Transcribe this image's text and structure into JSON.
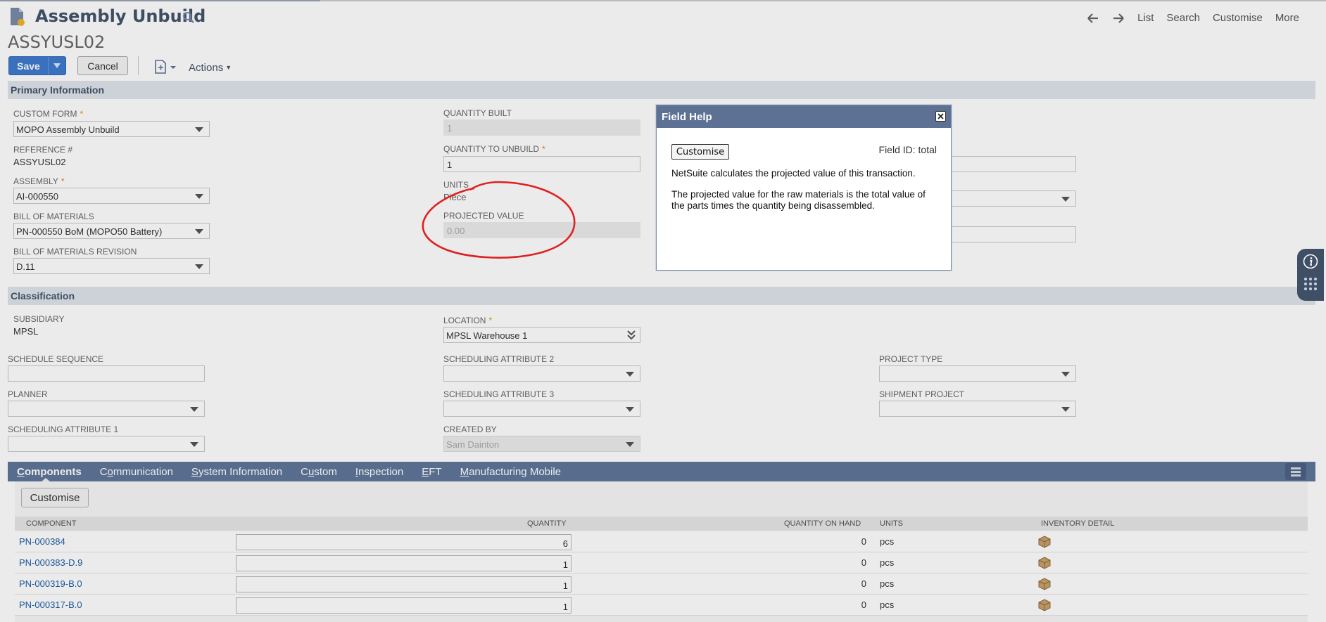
{
  "header": {
    "title": "Assembly Unbuild",
    "record_id": "ASSYUSL02",
    "nav": {
      "list": "List",
      "search": "Search",
      "customise": "Customise",
      "more": "More"
    }
  },
  "toolbar": {
    "save": "Save",
    "cancel": "Cancel",
    "actions": "Actions"
  },
  "primary": {
    "section_title": "Primary Information",
    "custom_form": {
      "label": "CUSTOM FORM",
      "value": "MOPO Assembly Unbuild"
    },
    "reference": {
      "label": "REFERENCE #",
      "value": "ASSYUSL02"
    },
    "assembly": {
      "label": "ASSEMBLY",
      "value": "AI-000550"
    },
    "bom": {
      "label": "BILL OF MATERIALS",
      "value": "PN-000550 BoM (MOPO50 Battery)"
    },
    "bom_rev": {
      "label": "BILL OF MATERIALS REVISION",
      "value": "D.11"
    },
    "qty_built": {
      "label": "QUANTITY BUILT",
      "value": "1"
    },
    "qty_unbuild": {
      "label": "QUANTITY TO UNBUILD",
      "value": "1"
    },
    "units": {
      "label": "UNITS",
      "value": "Piece"
    },
    "projected": {
      "label": "PROJECTED VALUE",
      "value": "0.00"
    }
  },
  "classification": {
    "section_title": "Classification",
    "subsidiary": {
      "label": "SUBSIDIARY",
      "value": "MPSL"
    },
    "location": {
      "label": "LOCATION",
      "value": "MPSL Warehouse 1"
    },
    "schedule_sequence": {
      "label": "SCHEDULE SEQUENCE",
      "value": ""
    },
    "sched_attr2": {
      "label": "SCHEDULING ATTRIBUTE 2",
      "value": ""
    },
    "project_type": {
      "label": "PROJECT TYPE",
      "value": ""
    },
    "planner": {
      "label": "PLANNER",
      "value": ""
    },
    "sched_attr3": {
      "label": "SCHEDULING ATTRIBUTE 3",
      "value": ""
    },
    "shipment_project": {
      "label": "SHIPMENT PROJECT",
      "value": ""
    },
    "sched_attr1": {
      "label": "SCHEDULING ATTRIBUTE 1",
      "value": ""
    },
    "created_by": {
      "label": "CREATED BY",
      "value": "Sam Dainton"
    }
  },
  "tabs": [
    {
      "first": "C",
      "rest": "omponents",
      "active": true
    },
    {
      "pre": "C",
      "first": "o",
      "rest": "mmunication"
    },
    {
      "first": "S",
      "rest": "ystem Information"
    },
    {
      "pre": "C",
      "first": "u",
      "rest": "stom"
    },
    {
      "first": "I",
      "rest": "nspection"
    },
    {
      "first": "E",
      "rest": "FT"
    },
    {
      "first": "M",
      "rest": "anufacturing Mobile"
    }
  ],
  "components": {
    "customise": "Customise",
    "columns": [
      "COMPONENT",
      "QUANTITY",
      "QUANTITY ON HAND",
      "UNITS",
      "INVENTORY DETAIL"
    ],
    "rows": [
      {
        "component": "PN-000384",
        "quantity": "6",
        "on_hand": "0",
        "units": "pcs"
      },
      {
        "component": "PN-000383-D.9",
        "quantity": "1",
        "on_hand": "0",
        "units": "pcs"
      },
      {
        "component": "PN-000319-B.0",
        "quantity": "1",
        "on_hand": "0",
        "units": "pcs"
      },
      {
        "component": "PN-000317-B.0",
        "quantity": "1",
        "on_hand": "0",
        "units": "pcs"
      }
    ]
  },
  "field_help": {
    "title": "Field Help",
    "customise": "Customise",
    "field_id": "Field ID: total",
    "p1": "NetSuite calculates the projected value of this transaction.",
    "p2": "The projected value for the raw materials is the total value of the parts times the quantity being disassembled."
  },
  "colors": {
    "accent": "#3e7bd0",
    "tabs": "#607799",
    "section": "#dfe4eb",
    "annotation": "#e02020"
  }
}
